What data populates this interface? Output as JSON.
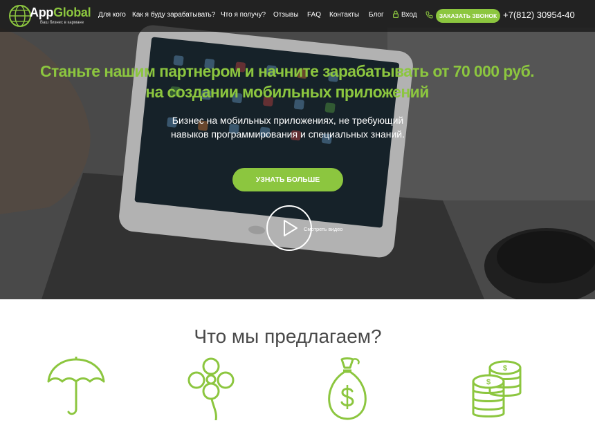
{
  "header": {
    "logo": {
      "name_main": "App",
      "name_accent": "Global",
      "tagline": "Ваш бизнес в кармане"
    },
    "nav": [
      {
        "label": "Для кого"
      },
      {
        "label": "Как я буду зарабатывать?"
      },
      {
        "label": "Что я получу?"
      },
      {
        "label": "Отзывы"
      },
      {
        "label": "FAQ"
      },
      {
        "label": "Контакты"
      },
      {
        "label": "Блог"
      },
      {
        "label": "Вход"
      }
    ],
    "call_button": "ЗАКАЗАТЬ ЗВОНОК",
    "phone": "+7(812) 30954-40"
  },
  "hero": {
    "title_line1": "Станьте нашим партнером и начните зарабатывать от 70 000 руб.",
    "title_line2": "на создании мобильных приложений",
    "subtitle_line1": "Бизнес на мобильных приложениях, не требующий",
    "subtitle_line2": "навыков программирования и специальных знаний.",
    "cta_button": "УЗНАТЬ БОЛЬШЕ",
    "video_label": "Смотреть видео"
  },
  "offers": {
    "title": "Что мы предлагаем?",
    "icons": [
      "umbrella-icon",
      "clover-icon",
      "money-bag-icon",
      "coins-stack-icon"
    ]
  },
  "colors": {
    "accent": "#8cc63f",
    "heading": "#4a4a4a",
    "header_bg": "#1a1a1a"
  }
}
